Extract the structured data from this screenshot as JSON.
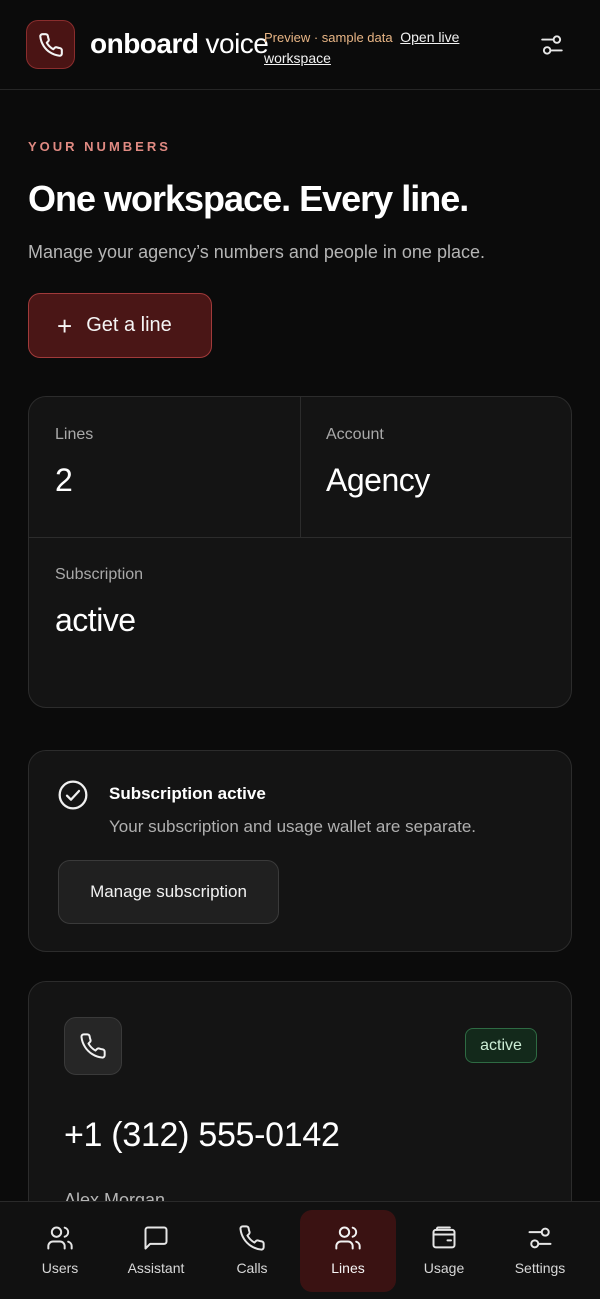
{
  "header": {
    "brand_bold": "onboard",
    "brand_light": "voice",
    "preview_text": "Preview · sample data",
    "open_live_link": "Open live workspace",
    "icons": {
      "logo": "phone-icon",
      "menu": "sliders-icon"
    }
  },
  "hero": {
    "eyebrow": "YOUR NUMBERS",
    "title": "One workspace. Every line.",
    "subtitle": "Manage your agency’s numbers and people in one place.",
    "get_line_plus": "+",
    "get_line_label": "Get a line"
  },
  "stats": {
    "lines_label": "Lines",
    "lines_value": "2",
    "account_label": "Account",
    "account_value": "Agency",
    "subscription_label": "Subscription",
    "subscription_value": "active"
  },
  "subscription_card": {
    "title": "Subscription active",
    "description": "Your subscription and usage wallet are separate.",
    "manage_button": "Manage subscription"
  },
  "line_card": {
    "status": "active",
    "phone_number": "+1 (312) 555-0142",
    "owner": "Alex Morgan"
  },
  "nav": {
    "items": [
      {
        "label": "Users",
        "icon": "users-icon"
      },
      {
        "label": "Assistant",
        "icon": "chat-icon"
      },
      {
        "label": "Calls",
        "icon": "phone-icon"
      },
      {
        "label": "Lines",
        "icon": "users-icon",
        "active": true
      },
      {
        "label": "Usage",
        "icon": "wallet-icon"
      },
      {
        "label": "Settings",
        "icon": "sliders-icon"
      }
    ]
  },
  "colors": {
    "background": "#0b0b0b",
    "accent": "#4a1616",
    "accent_border": "#a13a3a",
    "eyebrow": "#e08a82",
    "status_green": "#13291b"
  }
}
